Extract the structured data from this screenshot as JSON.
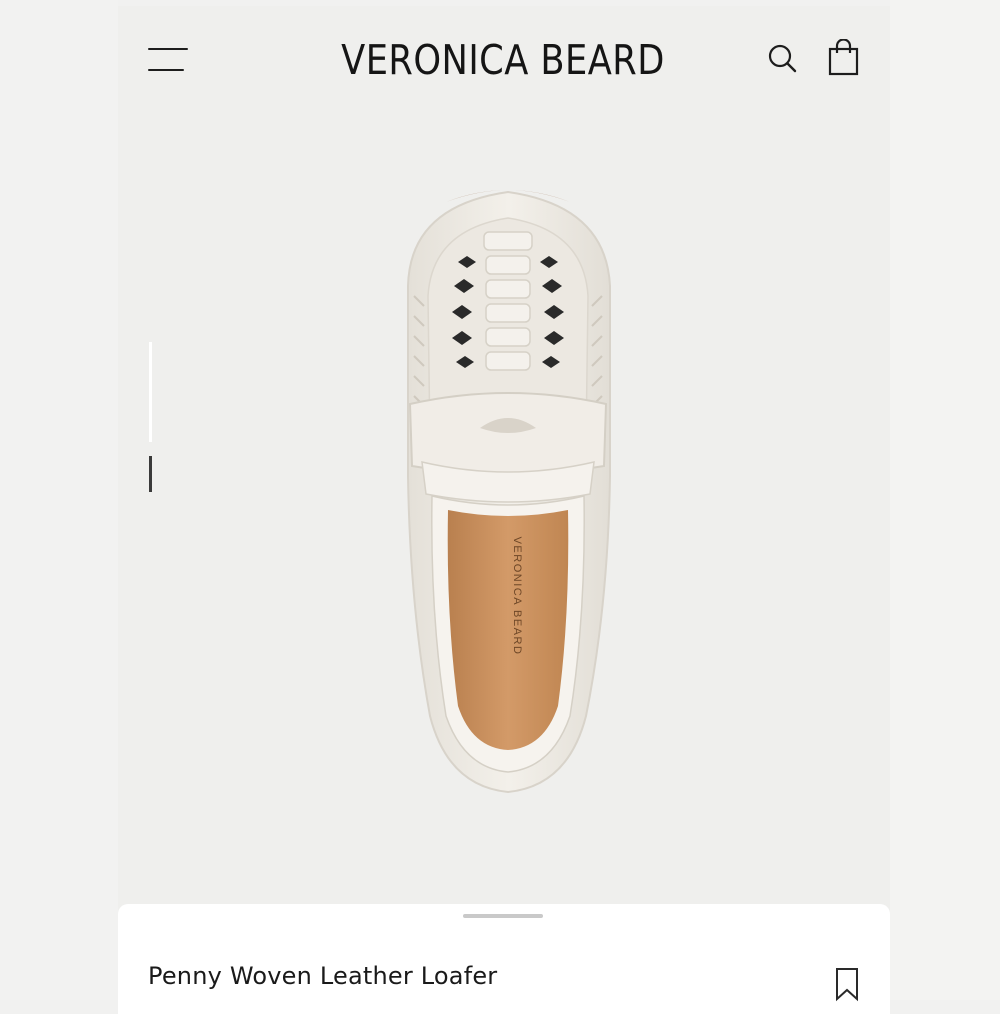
{
  "header": {
    "brand": "VERONICA BEARD",
    "icons": [
      "menu-icon",
      "search-icon",
      "shopping-bag-icon"
    ]
  },
  "gallery": {
    "insole_print": "VERONICA BEARD",
    "pager_icon": "image-pager-indicator"
  },
  "product": {
    "name": "Penny Woven Leather Loafer",
    "save_icon": "bookmark-icon"
  },
  "colors": {
    "page_background": "#f1f1f0",
    "sheet_background": "#ffffff",
    "text": "#1a1a1a",
    "leather": "#eeeae3",
    "insole": "#c98e5d"
  }
}
